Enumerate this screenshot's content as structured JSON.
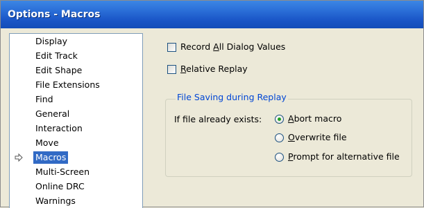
{
  "window": {
    "title": "Options - Macros"
  },
  "nav": {
    "items": [
      {
        "label": "Display",
        "selected": false
      },
      {
        "label": "Edit Track",
        "selected": false
      },
      {
        "label": "Edit Shape",
        "selected": false
      },
      {
        "label": "File Extensions",
        "selected": false
      },
      {
        "label": "Find",
        "selected": false
      },
      {
        "label": "General",
        "selected": false
      },
      {
        "label": "Interaction",
        "selected": false
      },
      {
        "label": "Move",
        "selected": false
      },
      {
        "label": "Macros",
        "selected": true
      },
      {
        "label": "Multi-Screen",
        "selected": false
      },
      {
        "label": "Online DRC",
        "selected": false
      },
      {
        "label": "Warnings",
        "selected": false
      }
    ],
    "pointer_icon": "arrow-right-icon"
  },
  "options": {
    "record_all": {
      "label_pre": "Record ",
      "label_key": "A",
      "label_post": "ll Dialog Values",
      "checked": false
    },
    "relative_replay": {
      "label_pre": "",
      "label_key": "R",
      "label_post": "elative Replay",
      "checked": false
    }
  },
  "file_saving": {
    "group_title": "File Saving during Replay",
    "field_label": "If file already exists:",
    "radios": [
      {
        "label_key": "A",
        "label_rest": "bort macro",
        "selected": true
      },
      {
        "label_key": "O",
        "label_rest": "verwrite file",
        "selected": false
      },
      {
        "label_key": "P",
        "label_rest": "rompt for alternative file",
        "selected": false
      }
    ]
  },
  "colors": {
    "title_bar": "#2b6fd8",
    "selection": "#316ac5",
    "group_title": "#0046d5",
    "radio_dot": "#21a121"
  }
}
